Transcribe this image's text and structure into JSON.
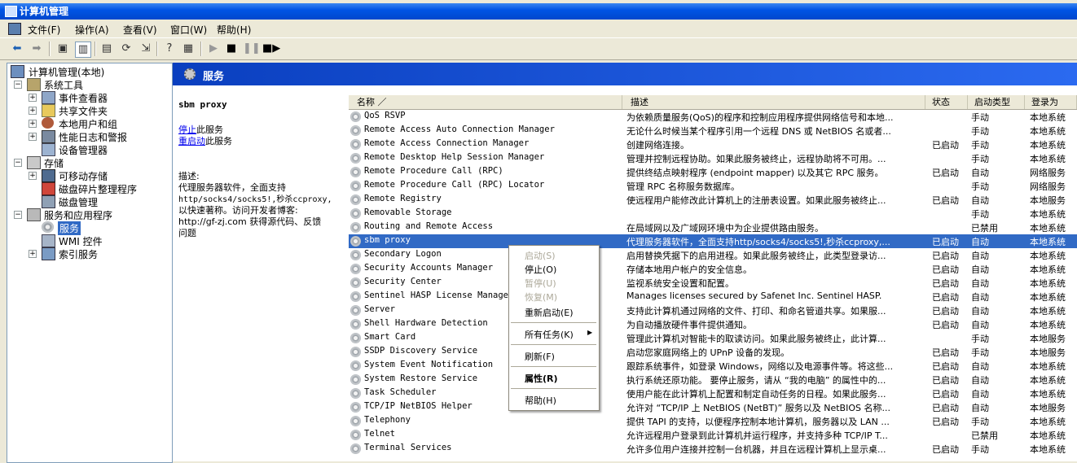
{
  "window": {
    "title": "计算机管理"
  },
  "menubar": {
    "items": [
      {
        "label": "文件(F)"
      },
      {
        "label": "操作(A)"
      },
      {
        "label": "查看(V)"
      },
      {
        "label": "窗口(W)"
      },
      {
        "label": "帮助(H)"
      }
    ]
  },
  "tree": {
    "root": "计算机管理(本地)",
    "system_tools": "系统工具",
    "event_viewer": "事件查看器",
    "shared_folders": "共享文件夹",
    "local_users": "本地用户和组",
    "perf_logs": "性能日志和警报",
    "device_manager": "设备管理器",
    "storage": "存储",
    "removable_storage": "可移动存储",
    "defrag": "磁盘碎片整理程序",
    "disk_mgmt": "磁盘管理",
    "services_apps": "服务和应用程序",
    "services": "服务",
    "wmi": "WMI 控件",
    "indexing": "索引服务"
  },
  "header": {
    "title": "服务"
  },
  "details": {
    "service_name": "sbm proxy",
    "stop_link": "停止",
    "stop_suffix": "此服务",
    "restart_link": "重启动",
    "restart_suffix": "此服务",
    "desc_label": "描述:",
    "desc_line1": "代理服务器软件，全面支持",
    "desc_line2": "http/socks4/socks5!,秒杀ccproxy,",
    "desc_line3": "以快速著称。访问开发者博客:",
    "desc_line4": "http://gf-zj.com 获得源代码、反馈",
    "desc_line5": "问题"
  },
  "columns": {
    "name": "名称 ／",
    "desc": "描述",
    "status": "状态",
    "startup": "启动类型",
    "logon": "登录为"
  },
  "services": [
    {
      "name": "QoS RSVP",
      "desc": "为依赖质量服务(QoS)的程序和控制应用程序提供网络信号和本地...",
      "status": "",
      "startup": "手动",
      "logon": "本地系统"
    },
    {
      "name": "Remote Access Auto Connection Manager",
      "desc": "无论什么时候当某个程序引用一个远程 DNS 或 NetBIOS 名或者...",
      "status": "",
      "startup": "手动",
      "logon": "本地系统"
    },
    {
      "name": "Remote Access Connection Manager",
      "desc": "创建网络连接。",
      "status": "已启动",
      "startup": "手动",
      "logon": "本地系统"
    },
    {
      "name": "Remote Desktop Help Session Manager",
      "desc": "管理并控制远程协助。如果此服务被终止，远程协助将不可用。...",
      "status": "",
      "startup": "手动",
      "logon": "本地系统"
    },
    {
      "name": "Remote Procedure Call (RPC)",
      "desc": "提供终结点映射程序 (endpoint mapper) 以及其它 RPC 服务。",
      "status": "已启动",
      "startup": "自动",
      "logon": "网络服务"
    },
    {
      "name": "Remote Procedure Call (RPC) Locator",
      "desc": "管理 RPC 名称服务数据库。",
      "status": "",
      "startup": "手动",
      "logon": "网络服务"
    },
    {
      "name": "Remote Registry",
      "desc": "使远程用户能修改此计算机上的注册表设置。如果此服务被终止...",
      "status": "已启动",
      "startup": "自动",
      "logon": "本地服务"
    },
    {
      "name": "Removable Storage",
      "desc": "",
      "status": "",
      "startup": "手动",
      "logon": "本地系统"
    },
    {
      "name": "Routing and Remote Access",
      "desc": "在局域网以及广域网环境中为企业提供路由服务。",
      "status": "",
      "startup": "已禁用",
      "logon": "本地系统"
    },
    {
      "name": "sbm proxy",
      "desc": "代理服务器软件，全面支持http/socks4/socks5!,秒杀ccproxy,...",
      "status": "已启动",
      "startup": "自动",
      "logon": "本地系统"
    },
    {
      "name": "Secondary Logon",
      "desc": "启用替换凭据下的启用进程。如果此服务被终止，此类型登录访...",
      "status": "已启动",
      "startup": "自动",
      "logon": "本地系统"
    },
    {
      "name": "Security Accounts Manager",
      "desc": "存储本地用户帐户的安全信息。",
      "status": "已启动",
      "startup": "自动",
      "logon": "本地系统"
    },
    {
      "name": "Security Center",
      "desc": "监视系统安全设置和配置。",
      "status": "已启动",
      "startup": "自动",
      "logon": "本地系统"
    },
    {
      "name": "Sentinel HASP License Manager",
      "desc": "Manages licenses secured by Safenet Inc. Sentinel HASP.",
      "status": "已启动",
      "startup": "自动",
      "logon": "本地系统"
    },
    {
      "name": "Server",
      "desc": "支持此计算机通过网络的文件、打印、和命名管道共享。如果服...",
      "status": "已启动",
      "startup": "自动",
      "logon": "本地系统"
    },
    {
      "name": "Shell Hardware Detection",
      "desc": "为自动播放硬件事件提供通知。",
      "status": "已启动",
      "startup": "自动",
      "logon": "本地系统"
    },
    {
      "name": "Smart Card",
      "desc": "管理此计算机对智能卡的取读访问。如果此服务被终止，此计算...",
      "status": "",
      "startup": "手动",
      "logon": "本地服务"
    },
    {
      "name": "SSDP Discovery Service",
      "desc": "启动您家庭网络上的 UPnP 设备的发现。",
      "status": "已启动",
      "startup": "手动",
      "logon": "本地服务"
    },
    {
      "name": "System Event Notification",
      "desc": "跟踪系统事件，如登录 Windows，网络以及电源事件等。将这些...",
      "status": "已启动",
      "startup": "自动",
      "logon": "本地系统"
    },
    {
      "name": "System Restore Service",
      "desc": "执行系统还原功能。 要停止服务，请从 “我的电脑” 的属性中的...",
      "status": "已启动",
      "startup": "自动",
      "logon": "本地系统"
    },
    {
      "name": "Task Scheduler",
      "desc": "使用户能在此计算机上配置和制定自动任务的日程。如果此服务...",
      "status": "已启动",
      "startup": "自动",
      "logon": "本地系统"
    },
    {
      "name": "TCP/IP NetBIOS Helper",
      "desc": "允许对 “TCP/IP 上 NetBIOS (NetBT)” 服务以及 NetBIOS 名称...",
      "status": "已启动",
      "startup": "自动",
      "logon": "本地服务"
    },
    {
      "name": "Telephony",
      "desc": "提供 TAPI 的支持，以便程序控制本地计算机，服务器以及 LAN ...",
      "status": "已启动",
      "startup": "手动",
      "logon": "本地系统"
    },
    {
      "name": "Telnet",
      "desc": "允许远程用户登录到此计算机并运行程序，并支持多种 TCP/IP T...",
      "status": "",
      "startup": "已禁用",
      "logon": "本地系统"
    },
    {
      "name": "Terminal Services",
      "desc": "允许多位用户连接并控制一台机器，并且在远程计算机上显示桌...",
      "status": "已启动",
      "startup": "手动",
      "logon": "本地系统"
    }
  ],
  "context_menu": {
    "start": "启动(S)",
    "stop": "停止(O)",
    "pause": "暂停(U)",
    "resume": "恢复(M)",
    "restart": "重新启动(E)",
    "all_tasks": "所有任务(K)",
    "refresh": "刷新(F)",
    "properties": "属性(R)",
    "help": "帮助(H)"
  }
}
